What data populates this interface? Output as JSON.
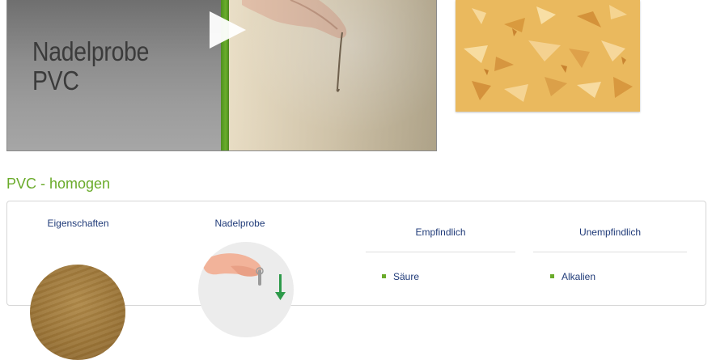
{
  "video": {
    "title_line1": "Nadelprobe",
    "title_line2": "PVC",
    "play_icon": "play-icon"
  },
  "sample": {
    "description_icon": "pvc-texture-swatch"
  },
  "section": {
    "title": "PVC - homogen"
  },
  "card": {
    "col1_title": "Eigenschaften",
    "col2_title": "Nadelprobe",
    "col3_title": "Empfindlich",
    "col4_title": "Unempfindlich",
    "col3_items": [
      "Säure"
    ],
    "col4_items": [
      "Alkalien"
    ]
  },
  "colors": {
    "accent_green": "#6aab2a",
    "text_blue": "#1f3a78",
    "sample_orange": "#e9b85c"
  }
}
